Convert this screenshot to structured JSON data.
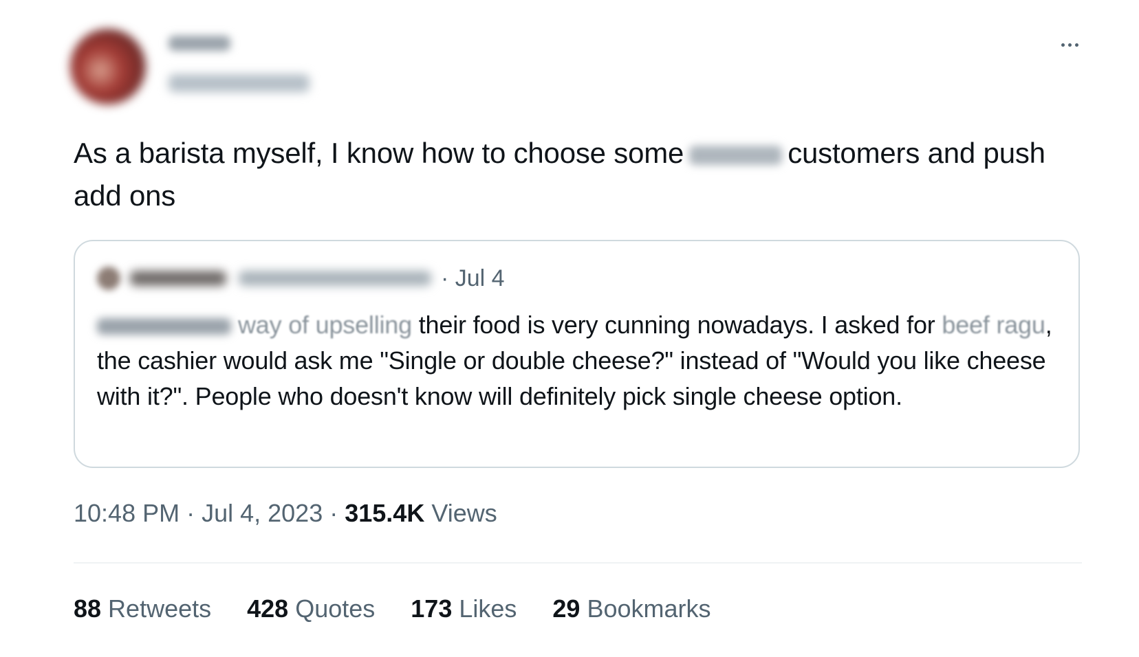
{
  "tweet": {
    "text_before": "As a barista myself, I know how to choose  some",
    "text_after": "customers and push add ons"
  },
  "quote": {
    "date": "· Jul 4",
    "text_faded": "way of upselling",
    "text_line1_rest": " their food is very cunning nowadays. I asked for ",
    "text_faded2": "beef ragu",
    "text_rest": ", the cashier would ask me \"Single or double cheese?\" instead of \"Would you like cheese with it?\". People who doesn't know will definitely pick single cheese option."
  },
  "meta": {
    "time": "10:48 PM",
    "sep1": " · ",
    "date": "Jul 4, 2023",
    "sep2": " · ",
    "views_count": "315.4K",
    "views_label": " Views"
  },
  "stats": [
    {
      "count": "88",
      "label": " Retweets"
    },
    {
      "count": "428",
      "label": " Quotes"
    },
    {
      "count": "173",
      "label": " Likes"
    },
    {
      "count": "29",
      "label": " Bookmarks"
    }
  ],
  "icons": {
    "more": "more-horizontal-icon"
  },
  "colors": {
    "text_primary": "#0f1419",
    "text_secondary": "#536471",
    "border": "#cfd9de"
  }
}
